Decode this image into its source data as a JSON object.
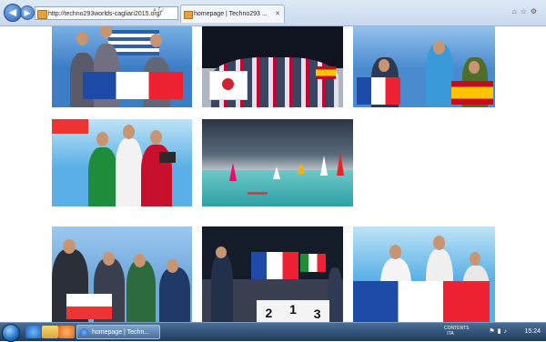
{
  "browser": {
    "address": "http://techno293worlds-cagliari2015.org/",
    "tab_title": "homepage | Techno293 ...",
    "back_icon": "back-arrow-icon",
    "forward_icon": "forward-arrow-icon",
    "tool_icons": [
      "home-icon",
      "star-icon",
      "gear-icon"
    ],
    "address_icons": [
      "search-icon",
      "refresh-icon"
    ]
  },
  "gallery": {
    "photos": [
      {
        "name": "podium-greece-france",
        "colors": [
          "#2f5fa8",
          "#ffffff",
          "#d22"
        ]
      },
      {
        "name": "group-japan-flag",
        "colors": [
          "#1a1a2a",
          "#ffffff",
          "#cc2233"
        ]
      },
      {
        "name": "winners-france-spain",
        "colors": [
          "#3a6db7",
          "#ffffff",
          "#f0c020"
        ]
      },
      {
        "name": "podium-italy-girls",
        "colors": [
          "#4da3d9",
          "#ffffff",
          "#1e8c3a"
        ]
      },
      {
        "name": "windsurf-race-stormy-sky",
        "colors": [
          "#3b4a5a",
          "#3fb6b6",
          "#ff5050"
        ]
      },
      {
        "name": "winners-waving-flags",
        "colors": [
          "#6fa8dc",
          "#ffffff",
          "#2e6a3d"
        ]
      },
      {
        "name": "podium-boys-night",
        "colors": [
          "#1b2433",
          "#ffffff",
          "#d32f2f"
        ]
      },
      {
        "name": "podium-213-france-italy",
        "colors": [
          "#121a28",
          "#ffffff",
          "#2a6dc4"
        ]
      },
      {
        "name": "girls-france-flag",
        "colors": [
          "#5ab0e6",
          "#ffffff",
          "#e53935"
        ]
      }
    ],
    "podium_numbers": [
      "2",
      "1",
      "3"
    ]
  },
  "taskbar": {
    "task_label": "homepage | Techn...",
    "lang": "CONTENTS ITA",
    "clock": "15:24",
    "tray_icons": [
      "flag-icon",
      "network-icon",
      "volume-icon"
    ]
  }
}
